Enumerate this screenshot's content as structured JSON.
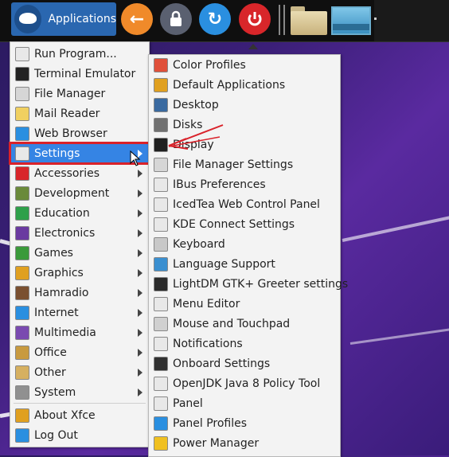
{
  "panel": {
    "app_button_label": "Applications",
    "launchers": [
      {
        "icon": "back-arrow-icon",
        "color": "#f08a2a",
        "glyph": "←"
      },
      {
        "icon": "lock-icon",
        "color": "#5a6070",
        "glyph": "🔒"
      },
      {
        "icon": "refresh-icon",
        "color": "#2a8fe0",
        "glyph": "↻"
      },
      {
        "icon": "power-icon",
        "color": "#d8262a",
        "glyph": "⏻"
      }
    ]
  },
  "menu": {
    "items": [
      {
        "label": "Run Program...",
        "icon": "run-icon",
        "color": "#e8e8e8"
      },
      {
        "label": "Terminal Emulator",
        "icon": "terminal-icon",
        "color": "#222222"
      },
      {
        "label": "File Manager",
        "icon": "folder-icon",
        "color": "#d6d6d6"
      },
      {
        "label": "Mail Reader",
        "icon": "mail-icon",
        "color": "#f0d060"
      },
      {
        "label": "Web Browser",
        "icon": "globe-icon",
        "color": "#2a8fe0"
      },
      {
        "label": "Settings",
        "icon": "settings-icon",
        "color": "#e8e8e8",
        "submenu": true,
        "active": true
      },
      {
        "label": "Accessories",
        "icon": "accessories-icon",
        "color": "#d8262a",
        "submenu": true
      },
      {
        "label": "Development",
        "icon": "development-icon",
        "color": "#6a8a3a",
        "submenu": true
      },
      {
        "label": "Education",
        "icon": "education-icon",
        "color": "#2ea04a",
        "submenu": true
      },
      {
        "label": "Electronics",
        "icon": "electronics-icon",
        "color": "#6a3aa0",
        "submenu": true
      },
      {
        "label": "Games",
        "icon": "games-icon",
        "color": "#3a9a3a",
        "submenu": true
      },
      {
        "label": "Graphics",
        "icon": "graphics-icon",
        "color": "#e0a020",
        "submenu": true
      },
      {
        "label": "Hamradio",
        "icon": "hamradio-icon",
        "color": "#7a5030",
        "submenu": true
      },
      {
        "label": "Internet",
        "icon": "internet-icon",
        "color": "#2a8fe0",
        "submenu": true
      },
      {
        "label": "Multimedia",
        "icon": "multimedia-icon",
        "color": "#7a4ab0",
        "submenu": true
      },
      {
        "label": "Office",
        "icon": "office-icon",
        "color": "#c89a40",
        "submenu": true
      },
      {
        "label": "Other",
        "icon": "other-icon",
        "color": "#d6b060",
        "submenu": true
      },
      {
        "label": "System",
        "icon": "system-icon",
        "color": "#909090",
        "submenu": true
      },
      {
        "label": "About Xfce",
        "icon": "about-icon",
        "color": "#e0a020"
      },
      {
        "label": "Log Out",
        "icon": "logout-icon",
        "color": "#2a8fe0"
      }
    ]
  },
  "settings_submenu": {
    "items": [
      {
        "label": "Color Profiles",
        "icon": "color-profiles-icon",
        "color": "#e0503a"
      },
      {
        "label": "Default Applications",
        "icon": "default-apps-icon",
        "color": "#e0a020"
      },
      {
        "label": "Desktop",
        "icon": "desktop-icon",
        "color": "#3a6aa0"
      },
      {
        "label": "Disks",
        "icon": "disks-icon",
        "color": "#707070"
      },
      {
        "label": "Display",
        "icon": "display-icon",
        "color": "#202020"
      },
      {
        "label": "File Manager Settings",
        "icon": "folder-icon",
        "color": "#d6d6d6"
      },
      {
        "label": "IBus Preferences",
        "icon": "ibus-icon",
        "color": "#e8e8e8"
      },
      {
        "label": "IcedTea Web Control Panel",
        "icon": "icedtea-icon",
        "color": "#e8e8e8"
      },
      {
        "label": "KDE Connect Settings",
        "icon": "kde-connect-icon",
        "color": "#e8e8e8"
      },
      {
        "label": "Keyboard",
        "icon": "keyboard-icon",
        "color": "#c8c8c8"
      },
      {
        "label": "Language Support",
        "icon": "language-icon",
        "color": "#3a8fd0"
      },
      {
        "label": "LightDM GTK+ Greeter settings",
        "icon": "lightdm-icon",
        "color": "#2a2a2a"
      },
      {
        "label": "Menu Editor",
        "icon": "menu-editor-icon",
        "color": "#e8e8e8"
      },
      {
        "label": "Mouse and Touchpad",
        "icon": "mouse-icon",
        "color": "#d0d0d0"
      },
      {
        "label": "Notifications",
        "icon": "notifications-icon",
        "color": "#e8e8e8"
      },
      {
        "label": "Onboard Settings",
        "icon": "onboard-icon",
        "color": "#303030"
      },
      {
        "label": "OpenJDK Java 8 Policy Tool",
        "icon": "java-icon",
        "color": "#e8e8e8"
      },
      {
        "label": "Panel",
        "icon": "panel-icon",
        "color": "#e8e8e8"
      },
      {
        "label": "Panel Profiles",
        "icon": "panel-profiles-icon",
        "color": "#2a8fe0"
      },
      {
        "label": "Power Manager",
        "icon": "power-manager-icon",
        "color": "#f0c020"
      }
    ]
  }
}
